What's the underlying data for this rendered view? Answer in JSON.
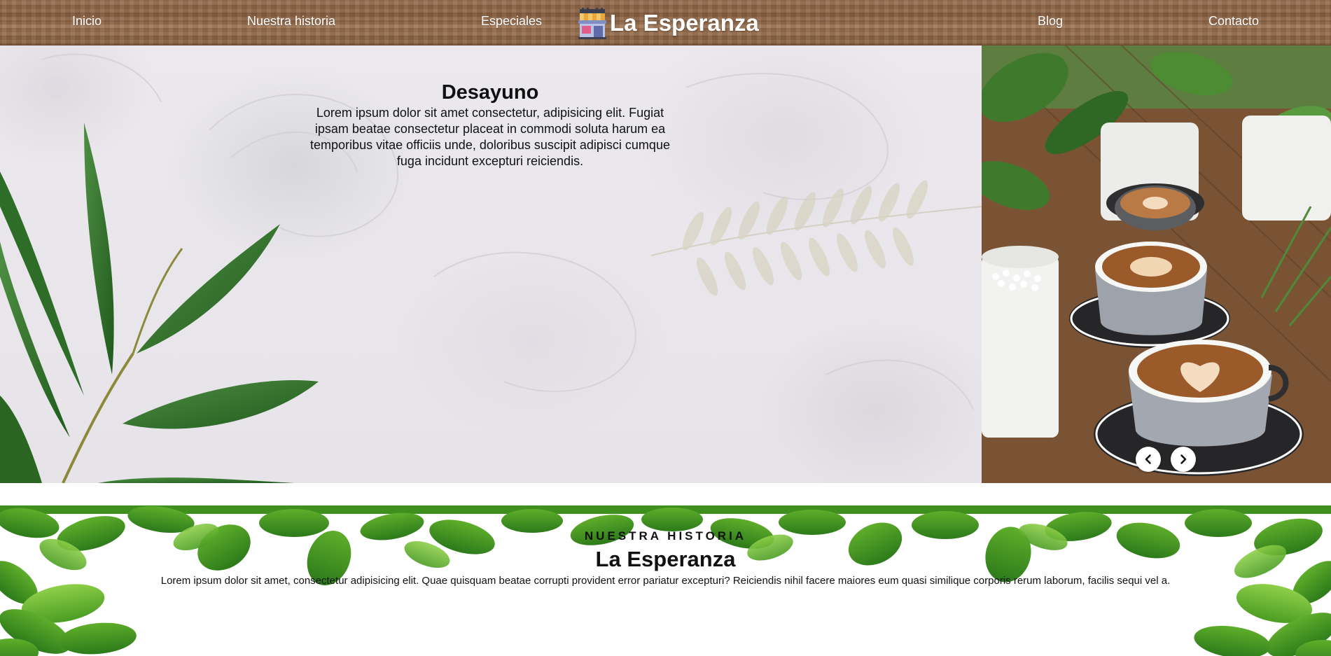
{
  "nav": {
    "links": [
      "Inicio",
      "Nuestra historia",
      "Especiales",
      "Blog",
      "Contacto"
    ],
    "brand": "La Esperanza",
    "logo_icon": "storefront-icon"
  },
  "hero": {
    "title": "Desayuno",
    "body": "Lorem ipsum dolor sit amet consectetur, adipisicing elit. Fugiat ipsam beatae consectetur placeat in commodi soluta harum ea temporibus vitae officiis unde, doloribus suscipit adipisci cumque fuga incidunt excepturi reiciendis.",
    "image_subject": "coffee-cups-and-plants-photo",
    "prev_icon": "chevron-left-icon",
    "next_icon": "chevron-right-icon"
  },
  "history": {
    "eyebrow": "NUESTRA HISTORIA",
    "title_light": "La",
    "title_bold": "Esperanza",
    "body": "Lorem ipsum dolor sit amet, consectetur adipisicing elit. Quae quisquam beatae corrupti provident error pariatur excepturi? Reiciendis nihil facere maiores eum quasi similique corporis rerum laborum, facilis sequi vel a."
  },
  "colors": {
    "nav_wood": "#8f6748",
    "leaf_green": "#2f7a1e",
    "text": "#111111",
    "nav_text": "#ffffff"
  }
}
